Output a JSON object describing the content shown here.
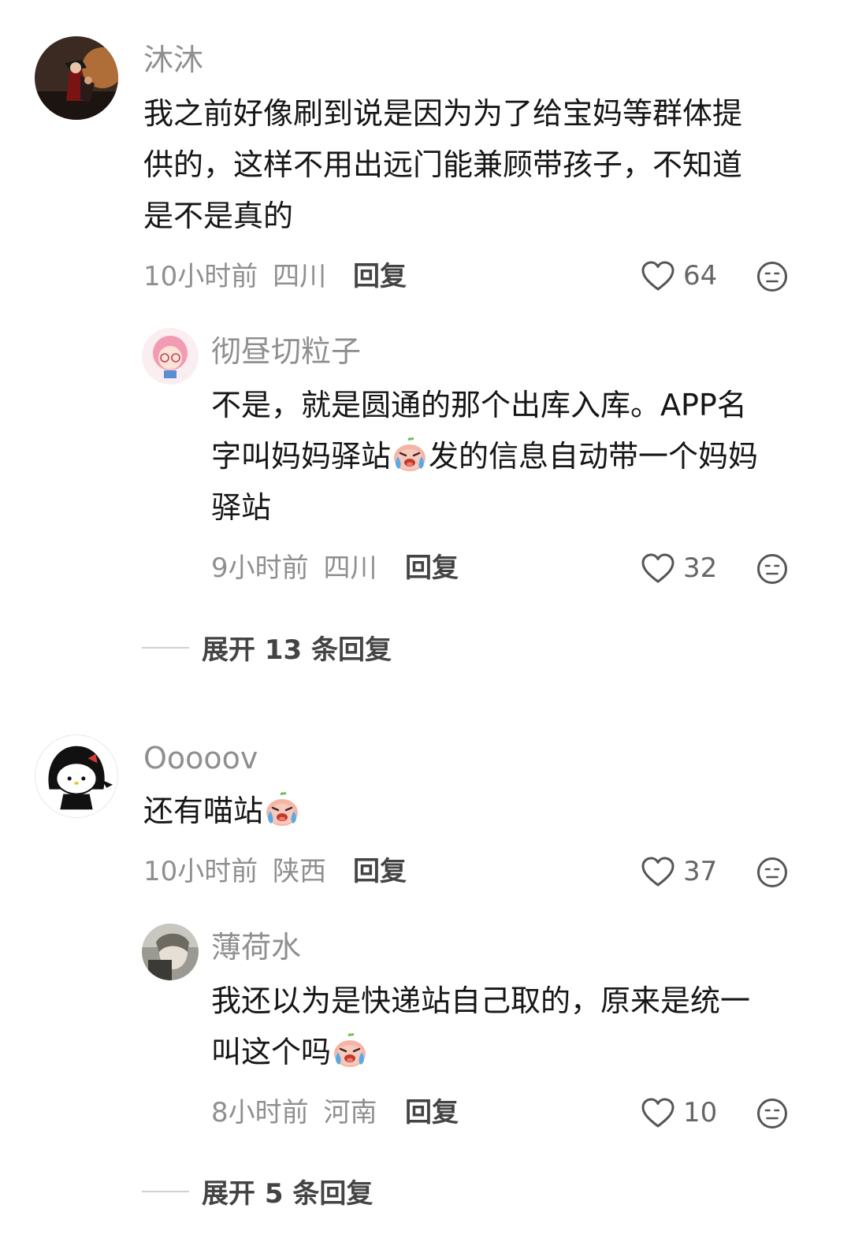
{
  "comments": [
    {
      "user": "沐沐",
      "text_lines": [
        "我之前好像刷到说是因为为了给宝妈等群体提",
        "供的，这样不用出远门能兼顾带孩子，不知道",
        "是不是真的"
      ],
      "time": "10小时前",
      "location": "四川",
      "reply_label": "回复",
      "likes": "64",
      "reply": {
        "user": "彻昼切粒子",
        "text_lines": [
          "不是，就是圆通的那个出库入库。APP名",
          "字叫妈妈驿站",
          "发的信息自动带一个妈妈",
          "驿站"
        ],
        "time": "9小时前",
        "location": "四川",
        "reply_label": "回复",
        "likes": "32"
      },
      "expand_label": "展开 13 条回复"
    },
    {
      "user": "Ooooov",
      "text": "还有喵站",
      "time": "10小时前",
      "location": "陕西",
      "reply_label": "回复",
      "likes": "37",
      "reply": {
        "user": "薄荷水",
        "text_lines": [
          "我还以为是快递站自己取的，原来是统一",
          "叫这个吗"
        ],
        "time": "8小时前",
        "location": "河南",
        "reply_label": "回复",
        "likes": "10"
      },
      "expand_label": "展开 5 条回复"
    }
  ],
  "icons": {
    "like": "heart-outline-icon",
    "dislike": "meh-face-icon",
    "emoji": "crying-face-emoji"
  },
  "colors": {
    "username": "#8f8f8f",
    "meta": "#8f8f8f",
    "reply_button": "#444444",
    "background": "#ffffff"
  }
}
